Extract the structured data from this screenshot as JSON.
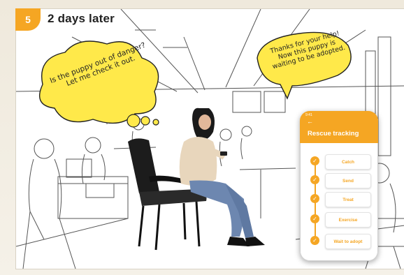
{
  "scene": {
    "step_number": "5",
    "caption": "2 days later"
  },
  "bubbles": {
    "left": "Is the puppy out of danger? Let me check it out.",
    "right": "Thanks for your help! Now this puppy is waiting to be adopted."
  },
  "phone": {
    "status": "9:41",
    "back_icon": "←",
    "title": "Rescue tracking",
    "steps": [
      {
        "label": "Catch",
        "icon": "check-icon"
      },
      {
        "label": "Send",
        "icon": "check-icon"
      },
      {
        "label": "Treat",
        "icon": "check-icon"
      },
      {
        "label": "Exercise",
        "icon": "check-icon"
      },
      {
        "label": "Wait to adopt",
        "icon": "check-icon"
      }
    ]
  },
  "colors": {
    "accent": "#f5a623",
    "bubble_fill": "#ffe94a",
    "ink": "#222222"
  }
}
